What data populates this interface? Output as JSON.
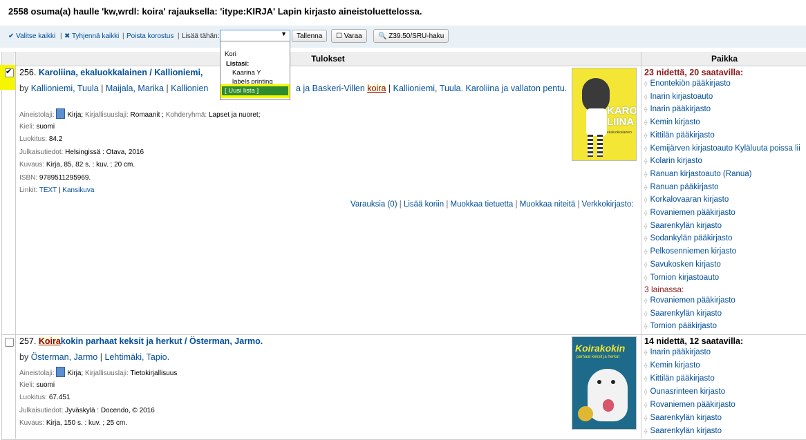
{
  "heading": "2558 osuma(a) haulle 'kw,wrdl: koira' rajauksella: 'itype:KIRJA' Lapin kirjasto aineistoluettelossa.",
  "toolbar": {
    "select_all": "Valitse kaikki",
    "clear_all": "Tyhjennä kaikki",
    "remove_highlight": "Poista korostus",
    "add_to": "Lisää tähän:",
    "save": "Tallenna",
    "reserve": "Varaa",
    "z3950": "Z39.50/SRU-haku"
  },
  "dropdown": {
    "items": [
      "Kori",
      "Listasi:",
      "Kaarina Y",
      "labels printing",
      "[ Uusi lista ]"
    ]
  },
  "table": {
    "col_results": "Tulokset",
    "col_location": "Paikka"
  },
  "results": [
    {
      "number": "256.",
      "title": "Karoliina, ekaluokkalainen / Kallioniemi,",
      "by": "by",
      "authors": [
        "Kallioniemi, Tuula",
        "Maijala, Marika",
        "Kallionien"
      ],
      "authors_tail_a": "a ja Baskeri-Villen ",
      "authors_tail_hl": "koira",
      "authors_tail_b": "Kallioniemi, Tuula. Karoliina ja vallaton pentu.",
      "item_type_label": "Aineistolaji:",
      "item_type": "Kirja",
      "lit_type_label": "Kirjallisuuslaji:",
      "lit_type": "Romaanit",
      "audience_label": "Kohderyhmä:",
      "audience": "Lapset ja nuoret;",
      "language_label": "Kieli:",
      "language": "suomi",
      "class_label": "Luokitus:",
      "class": "84.2",
      "pub_label": "Julkaisutiedot:",
      "pub": "Helsingissä : Otava, 2016",
      "desc_label": "Kuvaus:",
      "desc": "Kirja, 85, 82 s. : kuv. ; 20 cm.",
      "isbn_label": "ISBN:",
      "isbn": "9789511295969.",
      "links_label": "Linkit:",
      "link_text": "TEXT",
      "link_cover": "Kansikuva",
      "actions": [
        "Varauksia (0)",
        "Lisää koriin",
        "Muokkaa tietuetta",
        "Muokkaa niteitä",
        "Verkkokirjasto:"
      ],
      "availability": "23 nidettä, 20 saatavilla:",
      "libraries": [
        "Enontekiön pääkirjasto",
        "Inarin kirjastoauto",
        "Inarin pääkirjasto",
        "Kemin kirjasto",
        "Kittilän pääkirjasto",
        "Kemijärven kirjastoauto Kyläluuta poissa lii",
        "Kolarin kirjasto",
        "Ranuan kirjastoauto (Ranua)",
        "Ranuan pääkirjasto",
        "Korkalovaaran kirjasto",
        "Rovaniemen pääkirjasto",
        "Saarenkylän kirjasto",
        "Sodankylän pääkirjasto",
        "Pelkosenniemen kirjasto",
        "Savukosken kirjasto",
        "Tornion kirjastoauto"
      ],
      "on_loan": "3 lainassa:",
      "loan_libraries": [
        "Rovaniemen pääkirjasto",
        "Saarenkylän kirjasto",
        "Tornion pääkirjasto"
      ],
      "cover_text": "KARO LIINA",
      "cover_sub": "ekaluokkalainen"
    },
    {
      "number": "257.",
      "title_hl": "Koira",
      "title_rest": "kokin parhaat keksit ja herkut / Österman, Jarmo.",
      "by": "by",
      "authors": [
        "Österman, Jarmo",
        "Lehtimäki, Tapio."
      ],
      "item_type_label": "Aineistolaji:",
      "item_type": "Kirja",
      "lit_type_label": "Kirjallisuuslaji:",
      "lit_type": "Tietokirjallisuus",
      "language_label": "Kieli:",
      "language": "suomi",
      "class_label": "Luokitus:",
      "class": "67.451",
      "pub_label": "Julkaisutiedot:",
      "pub": "Jyväskylä : Docendo, © 2016",
      "desc_label": "Kuvaus:",
      "desc": "Kirja, 150 s. : kuv. ; 25 cm.",
      "availability": "14 nidettä, 12 saatavilla:",
      "libraries": [
        "Inarin pääkirjasto",
        "Kemin kirjasto",
        "Kittilän pääkirjasto",
        "Ounasrinteen kirjasto",
        "Rovaniemen pääkirjasto",
        "Saarenkylän kirjasto",
        "Saarenkylän kirjasto"
      ],
      "cover_text": "Koirakokin",
      "cover_sub": "parhaat keksit ja herkut"
    }
  ],
  "colors": {
    "link": "#004d99",
    "highlight": "#f6f600",
    "new_list": "#2e8b2e",
    "availability": "#8b1a1a"
  }
}
